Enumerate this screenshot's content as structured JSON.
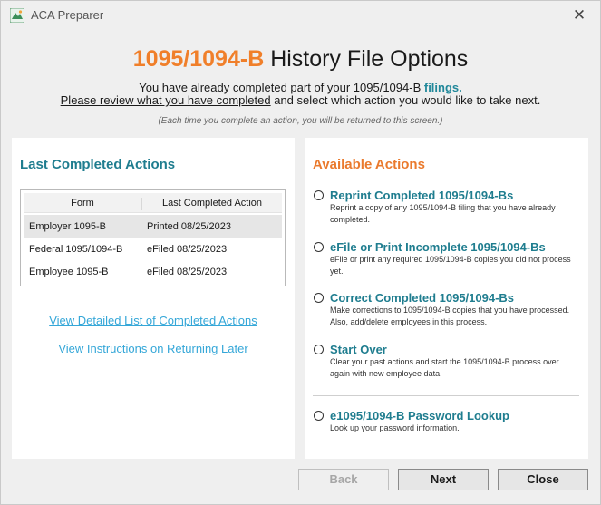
{
  "window": {
    "title": "ACA Preparer",
    "close_glyph": "✕",
    "app_icon": "aca-preparer-icon"
  },
  "header": {
    "title_accent": "1095/1094-B",
    "title_rest": " History File Options",
    "line1_prefix": "You have already completed part of your 1095/1094-B ",
    "line1_highlight": "filings.",
    "line2_underlined": "Please review what you have completed",
    "line2_rest": " and select which action you would like to take next.",
    "note": "(Each time you complete an action, you will be returned to this screen.)"
  },
  "left_panel": {
    "title": "Last Completed Actions",
    "columns": [
      "Form",
      "Last Completed Action"
    ],
    "rows": [
      {
        "form": "Employer 1095-B",
        "action": "Printed 08/25/2023",
        "selected": true
      },
      {
        "form": "Federal 1095/1094-B",
        "action": "eFiled 08/25/2023",
        "selected": false
      },
      {
        "form": "Employee 1095-B",
        "action": "eFiled 08/25/2023",
        "selected": false
      }
    ],
    "link_details": "View Detailed List of Completed Actions",
    "link_instructions": "View Instructions on Returning Later"
  },
  "right_panel": {
    "title": "Available Actions",
    "options": [
      {
        "title": "Reprint Completed 1095/1094-Bs",
        "desc": "Reprint a copy of any 1095/1094-B filing that you have already completed."
      },
      {
        "title": "eFile or Print Incomplete 1095/1094-Bs",
        "desc": "eFile or print any required 1095/1094-B copies you did not process yet."
      },
      {
        "title": "Correct Completed 1095/1094-Bs",
        "desc": "Make corrections to 1095/1094-B copies that you have processed.  Also, add/delete employees in this process."
      },
      {
        "title": "Start Over",
        "desc": "Clear your past actions and start the 1095/1094-B process over again with new employee data."
      },
      {
        "title": "e1095/1094-B Password Lookup",
        "desc": "Look up your password information."
      }
    ]
  },
  "footer": {
    "back": "Back",
    "next": "Next",
    "close": "Close"
  },
  "colors": {
    "accent_orange": "#f07f2a",
    "teal": "#1f7d8f",
    "link_blue": "#35a7d8"
  }
}
